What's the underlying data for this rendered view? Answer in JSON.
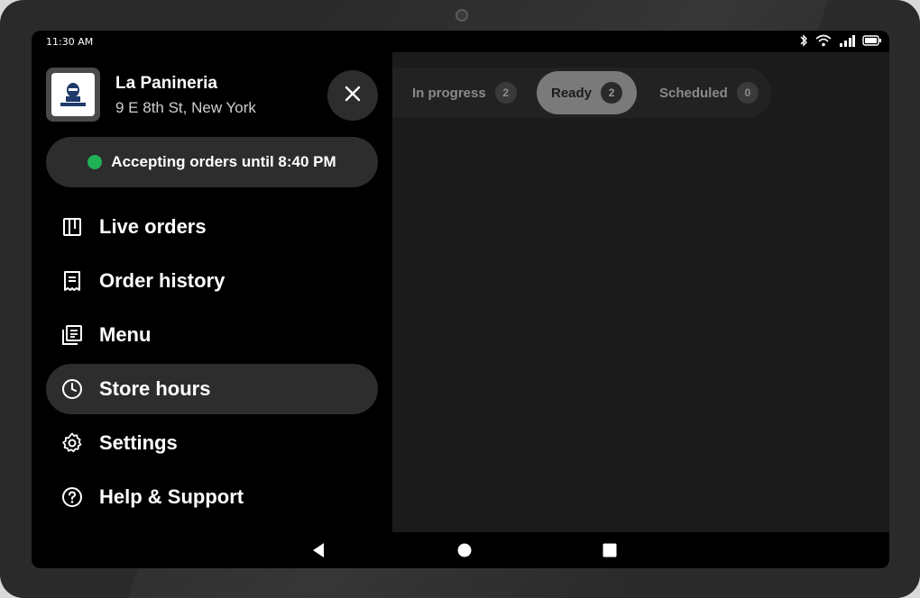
{
  "status_bar": {
    "time": "11:30 AM",
    "icons": [
      "bluetooth-icon",
      "wifi-icon",
      "signal-icon",
      "battery-icon"
    ]
  },
  "store": {
    "name": "La Panineria",
    "address": "9 E 8th St, New York",
    "logo_icon": "store-logo"
  },
  "accepting": {
    "label": "Accepting orders until 8:40 PM",
    "status_color": "#1fb154"
  },
  "nav": {
    "items": [
      {
        "label": "Live orders",
        "icon": "board-icon"
      },
      {
        "label": "Order history",
        "icon": "receipt-icon"
      },
      {
        "label": "Menu",
        "icon": "menu-book-icon"
      },
      {
        "label": "Store hours",
        "icon": "clock-icon",
        "active": true
      },
      {
        "label": "Settings",
        "icon": "gear-icon"
      },
      {
        "label": "Help & Support",
        "icon": "help-icon"
      }
    ]
  },
  "tabs": [
    {
      "label": "In progress",
      "count": "2"
    },
    {
      "label": "Ready",
      "count": "2",
      "active": true
    },
    {
      "label": "Scheduled",
      "count": "0"
    }
  ],
  "system_nav": [
    "back-icon",
    "home-icon",
    "recents-icon"
  ]
}
